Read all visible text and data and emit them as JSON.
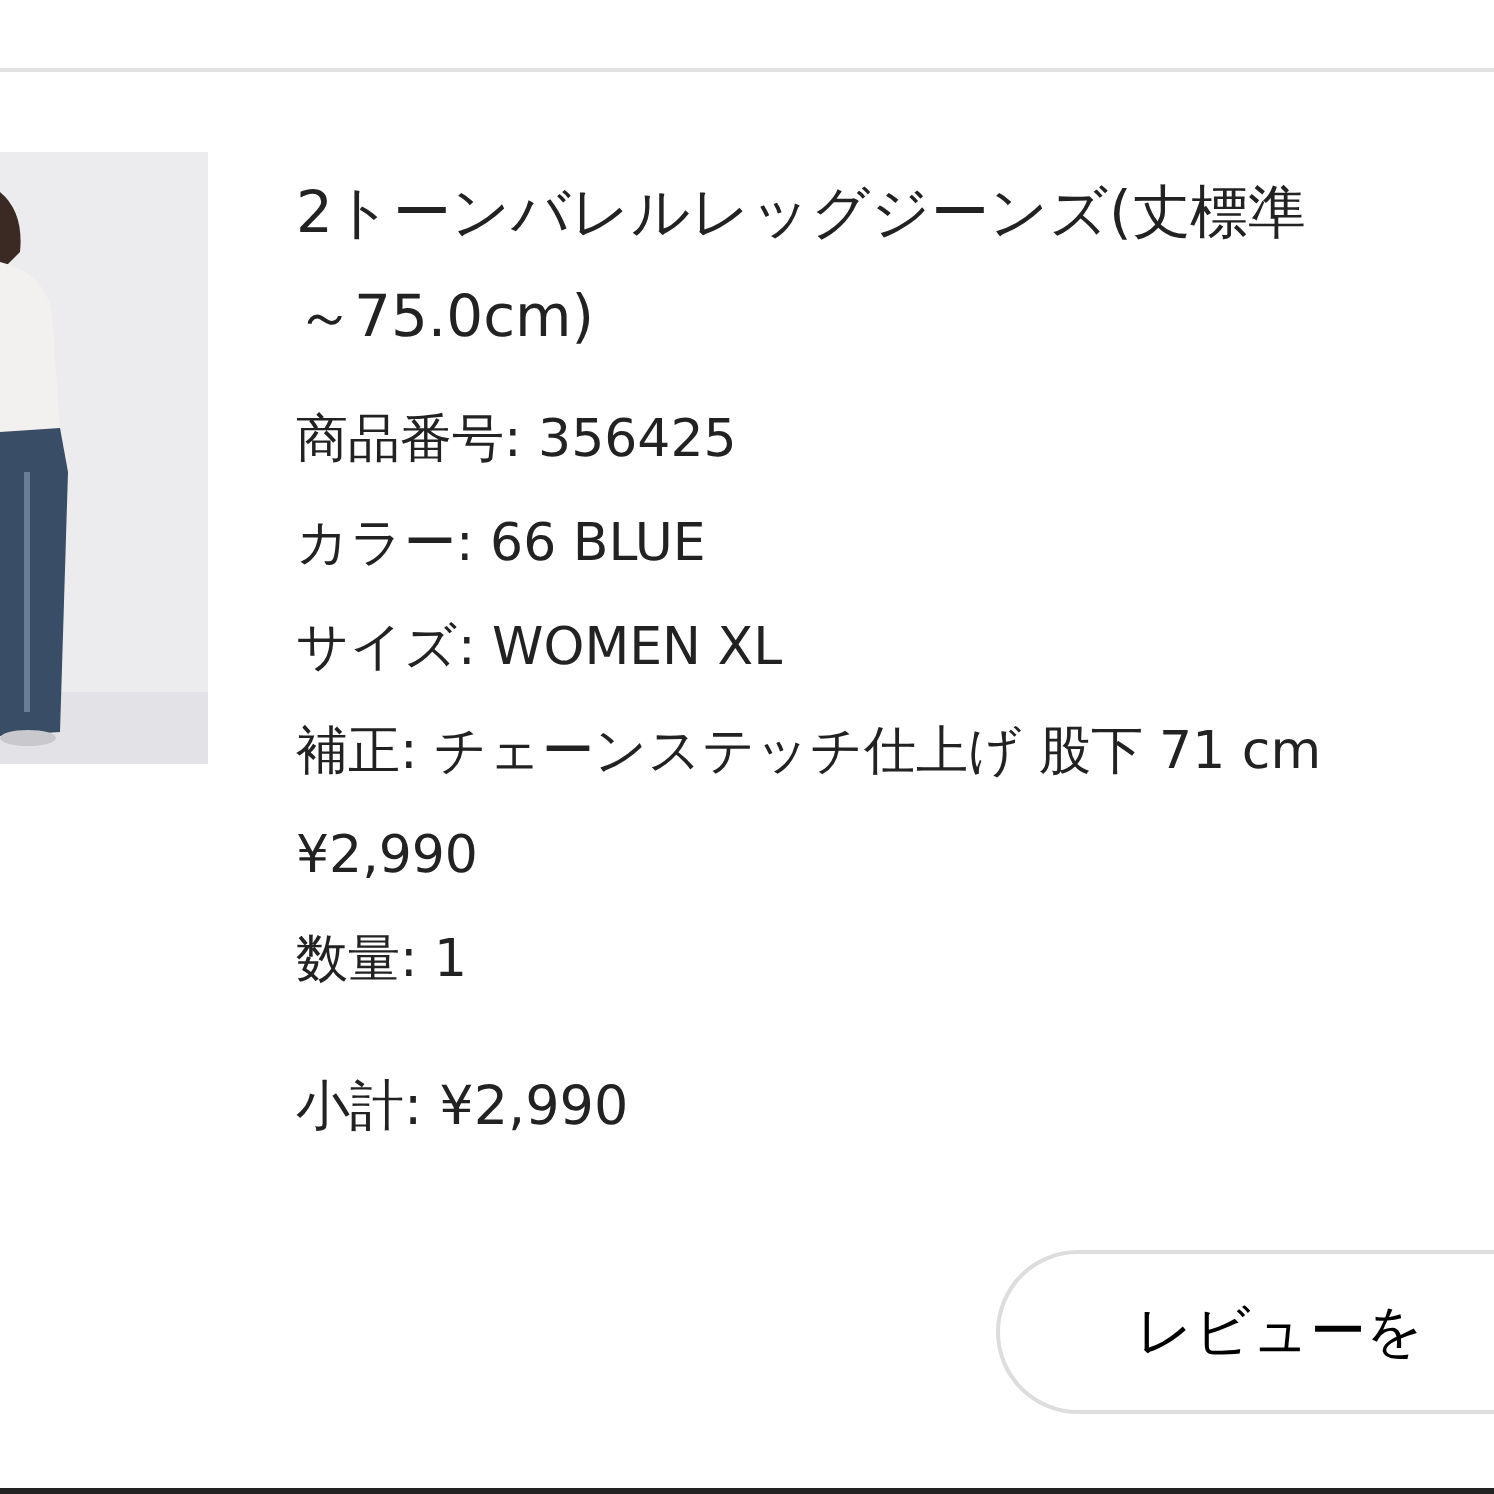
{
  "item": {
    "kind": "picture",
    "title_lines": [
      "2トーンバレルレッグジーンズ(丈標準",
      "～75.0cm)"
    ],
    "details": [
      "商品番号: 356425",
      "カラー: 66 BLUE",
      "サイズ: WOMEN XL",
      "補正: チェーンステッチ仕上げ 股下 71 cm",
      "¥2,990",
      "数量: 1"
    ],
    "subtotal": "小計: ¥2,990",
    "review_button": "レビューを"
  }
}
